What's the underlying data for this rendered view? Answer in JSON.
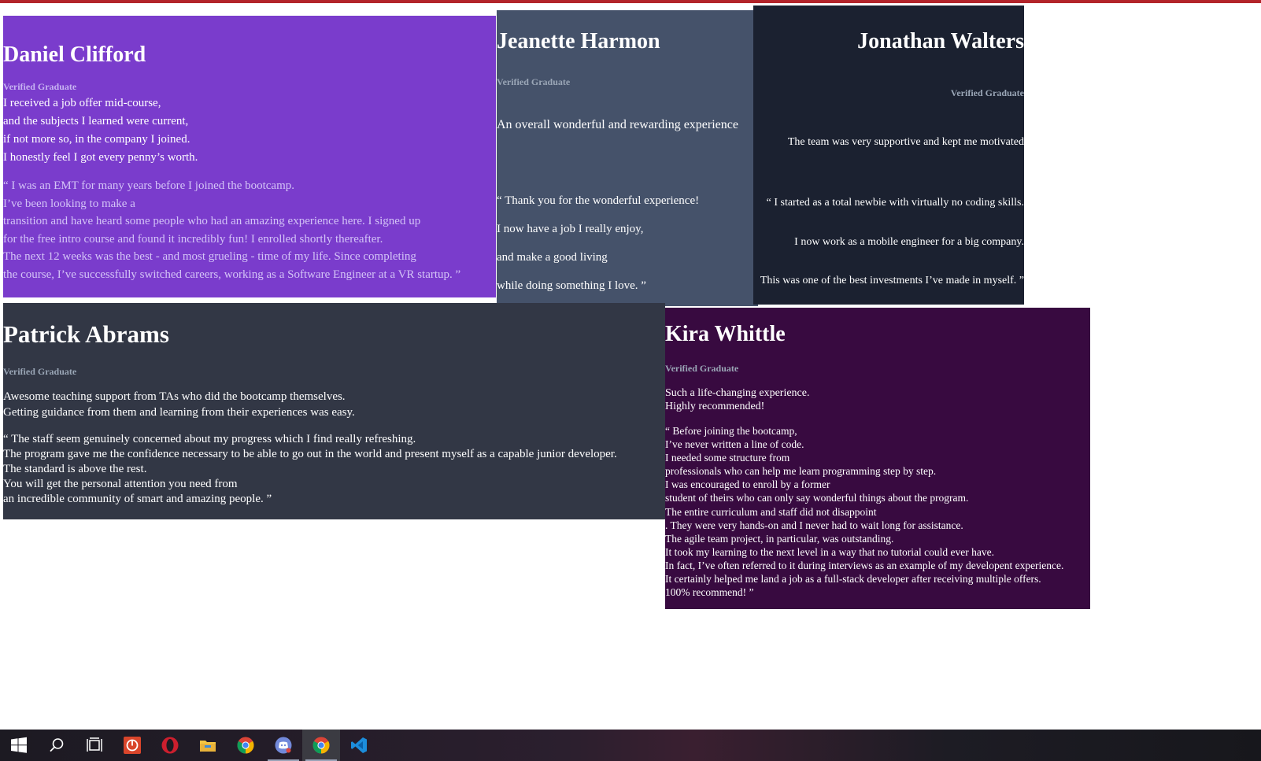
{
  "cards": {
    "daniel": {
      "name": "Daniel Clifford",
      "status": "Verified Graduate",
      "lead": "I received a job offer mid-course,\nand the subjects I learned were current,\nif not more so, in the company I joined.\nI honestly feel I got every penny’s worth.",
      "quote": "“ I was an EMT for many years before I joined the bootcamp.\nI’ve been looking to make a\ntransition and have heard some people who had an amazing experience here. I signed up\nfor the free intro course and found it incredibly fun! I enrolled shortly thereafter.\nThe next 12 weeks was the best - and most grueling - time of my life. Since completing\nthe course, I’ve successfully switched careers, working as a Software Engineer at a VR startup. ”"
    },
    "jeanette": {
      "name": "Jeanette Harmon",
      "status": "Verified Graduate",
      "lead": "An overall wonderful and rewarding experience",
      "quote": "“ Thank you for the wonderful experience!\nI now have a job I really enjoy,\nand make a good living\nwhile doing something I love. ”"
    },
    "jonathan": {
      "name": "Jonathan Walters",
      "status": "Verified Graduate",
      "lead": "The team was very supportive and kept me motivated",
      "quote": "“ I started as a total newbie with virtually no coding skills.\nI now work as a mobile engineer for a big company.\nThis was one of the best investments I’ve made in myself. ”"
    },
    "patrick": {
      "name": "Patrick Abrams",
      "status": "Verified Graduate",
      "lead": "Awesome teaching support from TAs who did the bootcamp themselves.\nGetting guidance from them and learning from their experiences was easy.",
      "quote": "“ The staff seem genuinely concerned about my progress which I find really refreshing.\nThe program gave me the confidence necessary to be able to go out in the world and present myself as a capable junior developer.\nThe standard is above the rest.\nYou will get the personal attention you need from\nan incredible community of smart and amazing people. ”"
    },
    "kira": {
      "name": "Kira Whittle",
      "status": "Verified Graduate",
      "lead": "Such a life-changing experience.\nHighly recommended!",
      "quote": "“ Before joining the bootcamp,\nI’ve never written a line of code.\nI needed some structure from\nprofessionals who can help me learn programming step by step.\nI was encouraged to enroll by a former\nstudent of theirs who can only say wonderful things about the program.\nThe entire curriculum and staff did not disappoint\n. They were very hands-on and I never had to wait long for assistance.\nThe agile team project, in particular, was outstanding.\nIt took my learning to the next level in a way that no tutorial could ever have.\nIn fact, I’ve often referred to it during interviews as an example of my developent experience.\nIt certainly helped me land a job as a full-stack developer after receiving multiple offers.\n100% recommend! ”"
    }
  },
  "colors": {
    "daniel_bg": "#7a3ccc",
    "jeanette_bg": "#45526a",
    "jonathan_bg": "#1b2130",
    "patrick_bg": "#323745",
    "kira_bg": "#380a40",
    "top_bar": "#b3242a"
  },
  "taskbar": {
    "icons": [
      "windows-start-icon",
      "search-icon",
      "task-view-icon",
      "app-power-icon",
      "opera-icon",
      "file-explorer-icon",
      "chrome-icon",
      "discord-icon",
      "chrome-active-icon",
      "vscode-icon"
    ]
  }
}
